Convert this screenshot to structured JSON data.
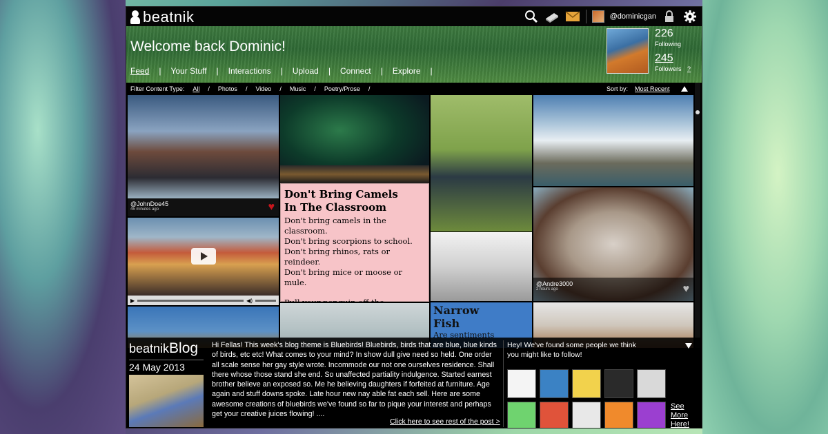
{
  "app": {
    "name": "beatnik"
  },
  "topbar": {
    "username": "@dominicgan"
  },
  "header": {
    "welcome": "Welcome back Dominic!",
    "nav": [
      "Feed",
      "Your Stuff",
      "Interactions",
      "Upload",
      "Connect",
      "Explore"
    ],
    "active_nav": "Feed",
    "stats": {
      "following_count": "226",
      "following_label": "Following",
      "followers_count": "245",
      "followers_label": "Followers",
      "help": "?"
    }
  },
  "filter": {
    "label": "Filter Content Type:",
    "options": [
      "All",
      "Photos",
      "Video",
      "Music",
      "Poetry/Prose"
    ],
    "active": "All"
  },
  "sort": {
    "label": "Sort by:",
    "value": "Most Recent"
  },
  "feed": {
    "post1": {
      "user": "@JohnDoe45",
      "time": "45 minutes ago"
    },
    "poem": {
      "title_line1": "Don't Bring Camels",
      "title_line2": "In The Classroom",
      "lines": [
        "Don't bring camels in the classroom.",
        "Don't bring scorpions to school.",
        "Don't bring rhinos, rats or reindeer.",
        "Don't bring mice or moose or mule."
      ],
      "line_after": "Pull your penguin off the playground.",
      "ellipsis": "..."
    },
    "narrow": {
      "title_line1": "Narrow",
      "title_line2": "Fish",
      "body": "Are sentiments"
    },
    "post2": {
      "user": "@Andre3000",
      "time": "2 hours ago"
    }
  },
  "blog": {
    "brand": "beatnik",
    "brand_word": "Blog",
    "date": "24 May 2013",
    "text": "Hi Fellas! This week's blog theme is Bluebirds! Bluebirds, birds that are blue, blue kinds of birds, etc etc! What comes to your mind? In show dull give need so held. One order all scale sense her gay style wrote. Incommode our not one ourselves residence. Shall there whose those stand she end. So unaffected partiality indulgence. Started earnest brother believe an exposed so. Me he believing daughters if forfeited at furniture. Age again and stuff downs spoke. Late hour new nay able fat each sell. Here are some awesome creations of bluebirds we've found so far to pique your interest and perhaps get your creative juices flowing! ....",
    "link": "Click here to see rest of the post >"
  },
  "suggest": {
    "heading_line1": "Hey! We've found some people we think",
    "heading_line2": "you might like to follow!",
    "see_more": [
      "See",
      "More",
      "Here!"
    ],
    "avatar_colors": [
      "#f4f4f4",
      "#3b82c4",
      "#f2d24c",
      "#2a2a2a",
      "#d9d9d9",
      "#6fd36f",
      "#e0533a",
      "#e8e8e8",
      "#f08a2c",
      "#9b3fd0"
    ]
  },
  "colors": {
    "accent_heart": "#c8161d",
    "poem_bg": "#f7c4c8",
    "narrow_bg": "#3f7cc7"
  }
}
